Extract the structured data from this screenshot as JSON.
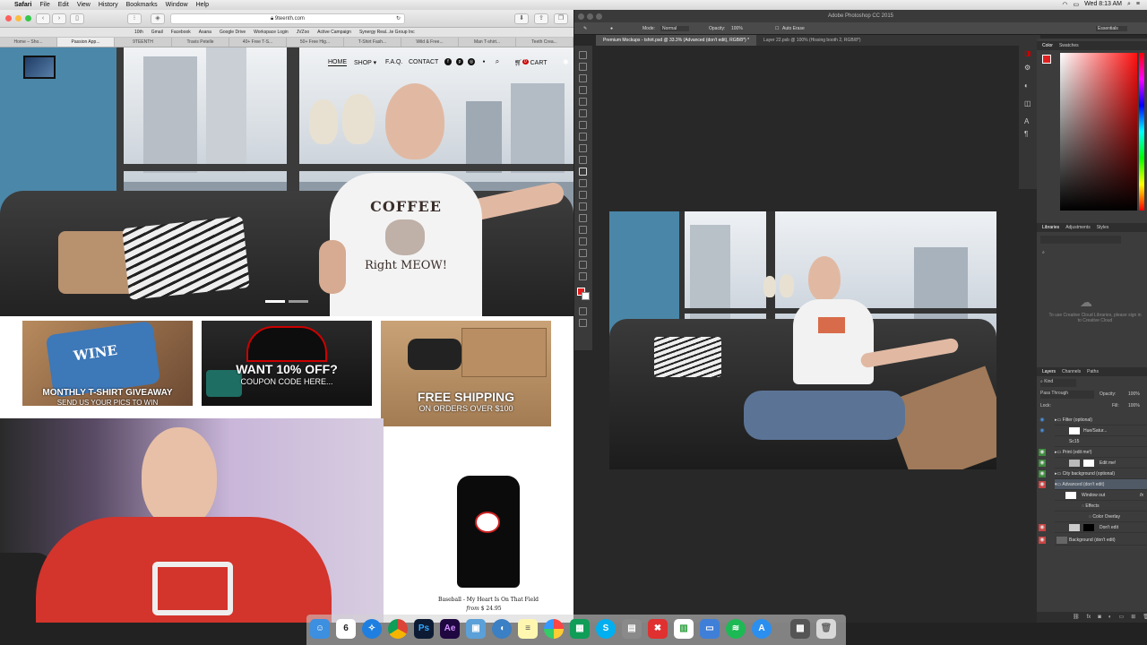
{
  "menubar": {
    "app": "Safari",
    "items": [
      "File",
      "Edit",
      "View",
      "History",
      "Bookmarks",
      "Window",
      "Help"
    ],
    "clock": "Wed 8:13 AM"
  },
  "safari": {
    "url": "9teenth.com",
    "favorites": [
      "10th",
      "Gmail",
      "Facebook",
      "Asana",
      "Google Drive",
      "Workspace Login",
      "JVZoo",
      "Active Campaign",
      "Synergy Real...te Group Inc"
    ],
    "tabs": [
      "Home – Sho...",
      "Passion App...",
      "9TEENTH",
      "Travis Petelle",
      "40+ Free T-S...",
      "50+ Free Hig...",
      "T-Shirt Fash...",
      "Wild & Free...",
      "Man T-shirt...",
      "Teeth Crea..."
    ],
    "active_tab_index": 1
  },
  "site": {
    "nav": [
      "HOME",
      "SHOP",
      "F.A.Q.",
      "CONTACT"
    ],
    "shop_arrow": "▾",
    "cart_label": "CART",
    "cart_count": "0",
    "hero_shirt_line1": "COFFEE",
    "hero_shirt_line2": "Right MEOW!",
    "promos": [
      {
        "title": "MONTHLY T-SHIRT GIVEAWAY",
        "subtitle": "SEND US YOUR PICS TO WIN",
        "shirt_text": "WINE"
      },
      {
        "title": "WANT 10% OFF?",
        "subtitle": "COUPON CODE HERE..."
      },
      {
        "title": "FREE SHIPPING",
        "subtitle": "ON ORDERS OVER $100"
      }
    ],
    "product": {
      "name": "Baseball - My Heart Is On That Field",
      "price_prefix": "from",
      "price": "$ 24.95"
    }
  },
  "photoshop": {
    "title": "Adobe Photoshop CC 2015",
    "workspace": "Essentials",
    "options": {
      "mode_label": "Mode:",
      "mode": "Normal",
      "opacity_label": "Opacity:",
      "opacity": "100%",
      "auto_erase": "Auto Erase"
    },
    "doc_tabs": [
      "Premium Mockups - tshirt.psd @ 33.3% (Advanced (don't edit), RGB/8*) *",
      "Layer 22.psb @ 100% (Hissing booth 2, RGB/8*)"
    ],
    "color_tabs": [
      "Color",
      "Swatches"
    ],
    "library_tabs": [
      "Libraries",
      "Adjustments",
      "Styles"
    ],
    "library_message": "To use Creative Cloud Libraries, please sign in to Creative Cloud",
    "layers_tabs": [
      "Layers",
      "Channels",
      "Paths"
    ],
    "kind_label": "Kind",
    "blend": "Pass Through",
    "opacity_label": "Opacity:",
    "opacity": "100%",
    "lock_label": "Lock:",
    "fill_label": "Fill:",
    "fill": "100%",
    "layers": [
      {
        "name": "Filter (optional)",
        "eye": "blue"
      },
      {
        "name": "Hue/Satur...",
        "eye": "blue"
      },
      {
        "name": "Sc15",
        "eye": "none"
      },
      {
        "name": "Print (edit me!)",
        "eye": "green"
      },
      {
        "name": "Edit me!",
        "eye": "green"
      },
      {
        "name": "City background (optional)",
        "eye": "green"
      },
      {
        "name": "Advanced (don't edit)",
        "eye": "red"
      },
      {
        "name": "Window out",
        "eye": "none",
        "fx": "fx"
      },
      {
        "name": "Effects",
        "eye": "none"
      },
      {
        "name": "Color Overlay",
        "eye": "none"
      },
      {
        "name": "Don't edit",
        "eye": "red"
      },
      {
        "name": "Background (don't edit)",
        "eye": "red"
      }
    ],
    "accent": "#e02020"
  },
  "dock": {
    "calendar_day": "6",
    "apps": [
      "Finder",
      "Calendar",
      "Safari",
      "Chrome",
      "Photoshop",
      "After Effects",
      "Preview",
      "Sequel",
      "Notes",
      "Photos",
      "Sheets",
      "Skype",
      "Scripts",
      "XMind",
      "Numbers",
      "Keynote",
      "Spotify",
      "App Store",
      "Screenshot",
      "Trash"
    ],
    "labels": {
      "photoshop": "Ps",
      "after_effects": "Ae",
      "skype": "S"
    }
  }
}
